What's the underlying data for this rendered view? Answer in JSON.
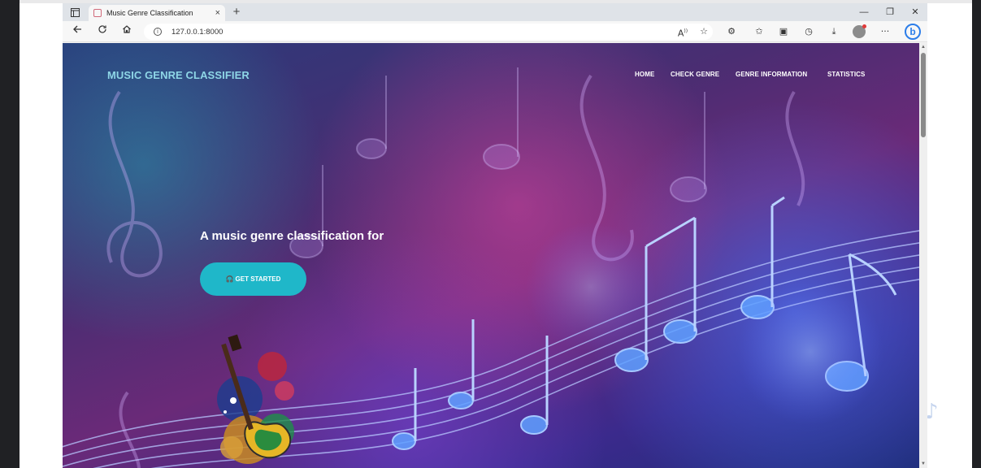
{
  "browser": {
    "tab_title": "Music Genre Classification",
    "tab_close": "×",
    "new_tab": "+",
    "url": "127.0.0.1:8000",
    "window_minimize": "—",
    "window_restore": "❐",
    "window_close": "✕",
    "more": "···"
  },
  "site": {
    "brand": "MUSIC GENRE CLASSIFIER",
    "nav": [
      "HOME",
      "CHECK GENRE",
      "GENRE INFORMATION",
      "STATISTICS"
    ],
    "hero_title": "A music genre classification for",
    "cta_label": "GET STARTED"
  },
  "colors": {
    "brand": "#8ed6e6",
    "cta": "#1fb7c9",
    "tab_bar": "#dfe3e8"
  },
  "icons": {
    "back": "back-arrow-icon",
    "refresh": "refresh-icon",
    "home": "home-icon",
    "info": "info-icon",
    "read_aloud": "read-aloud-icon",
    "favorite_add": "add-favorite-icon",
    "extensions": "extensions-icon",
    "favorites": "favorites-icon",
    "collections": "collections-icon",
    "history": "history-icon",
    "downloads": "download-icon",
    "headphones": "headphones-icon"
  }
}
